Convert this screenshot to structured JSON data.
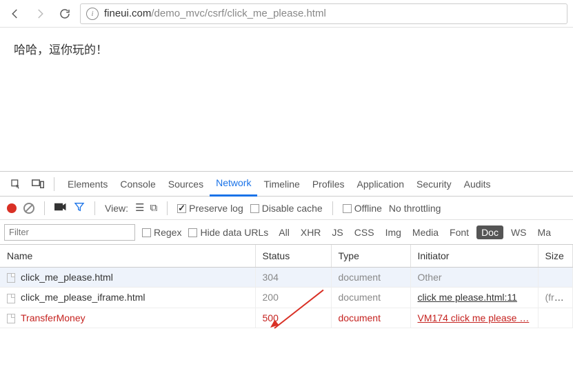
{
  "browser": {
    "url_domain": "fineui.com",
    "url_path": "/demo_mvc/csrf/click_me_please.html"
  },
  "page": {
    "text": "哈哈，逗你玩的！"
  },
  "devtools": {
    "tabs": [
      "Elements",
      "Console",
      "Sources",
      "Network",
      "Timeline",
      "Profiles",
      "Application",
      "Security",
      "Audits"
    ],
    "active_tab": "Network"
  },
  "netbar1": {
    "view_label": "View:",
    "preserve_log": "Preserve log",
    "disable_cache": "Disable cache",
    "offline": "Offline",
    "throttling": "No throttling"
  },
  "netbar2": {
    "filter_placeholder": "Filter",
    "regex": "Regex",
    "hide_urls": "Hide data URLs",
    "types": [
      "All",
      "XHR",
      "JS",
      "CSS",
      "Img",
      "Media",
      "Font",
      "Doc",
      "WS",
      "Ma"
    ],
    "active_type": "Doc"
  },
  "table": {
    "cols": {
      "name": "Name",
      "status": "Status",
      "type": "Type",
      "initiator": "Initiator",
      "size": "Size"
    },
    "rows": [
      {
        "name": "click_me_please.html",
        "status": "304",
        "type": "document",
        "initiator": "Other",
        "size": "",
        "error": false,
        "init_link": false,
        "highlight": true
      },
      {
        "name": "click_me_please_iframe.html",
        "status": "200",
        "type": "document",
        "initiator": "click me please.html:11",
        "size": "(from c",
        "error": false,
        "init_link": true,
        "highlight": false
      },
      {
        "name": "TransferMoney",
        "status": "500",
        "type": "document",
        "initiator": "VM174 click me please …",
        "size": "",
        "error": true,
        "init_link": true,
        "highlight": false
      }
    ]
  }
}
